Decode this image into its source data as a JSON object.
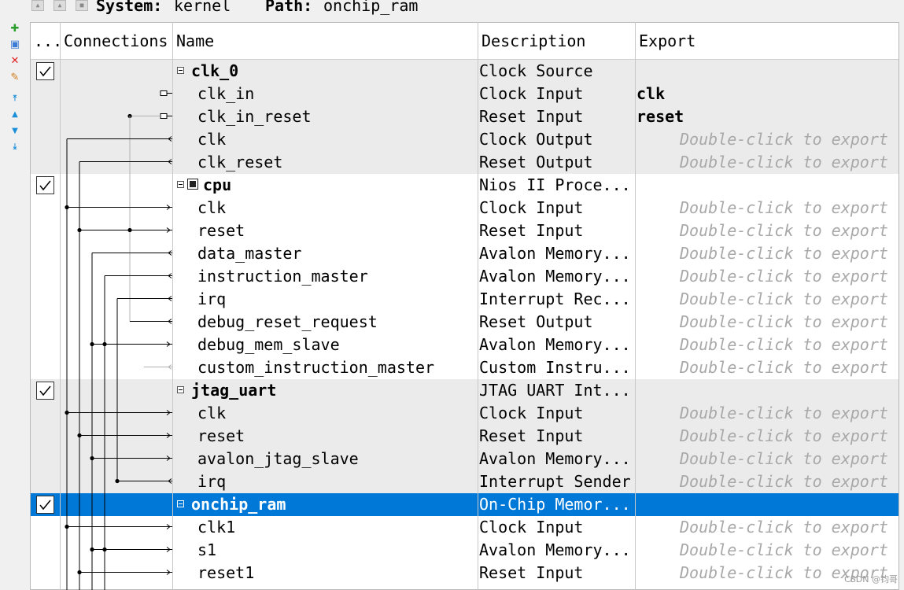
{
  "toolbar": {
    "system_label": "System:",
    "system_value": "kernel",
    "path_label": "Path:",
    "path_value": "onchip_ram"
  },
  "columns": [
    "...",
    "Connections",
    "Name",
    "Description",
    "Export"
  ],
  "rows": [
    {
      "type": "component",
      "checked": true,
      "name": "clk_0",
      "description": "Clock Source",
      "export": "",
      "bg": "grey",
      "has_cpu_icon": false
    },
    {
      "type": "port",
      "name": "clk_in",
      "description": "Clock Input",
      "export": "clk",
      "export_hint": false,
      "bg": "grey"
    },
    {
      "type": "port",
      "name": "clk_in_reset",
      "description": "Reset Input",
      "export": "reset",
      "export_hint": false,
      "bg": "grey"
    },
    {
      "type": "port",
      "name": "clk",
      "description": "Clock Output",
      "export": "Double-click to export",
      "export_hint": true,
      "bg": "grey"
    },
    {
      "type": "port",
      "name": "clk_reset",
      "description": "Reset Output",
      "export": "Double-click to export",
      "export_hint": true,
      "bg": "grey"
    },
    {
      "type": "component",
      "checked": true,
      "name": "cpu",
      "description": "Nios II Proce...",
      "export": "",
      "bg": "white",
      "has_cpu_icon": true
    },
    {
      "type": "port",
      "name": "clk",
      "description": "Clock Input",
      "export": "Double-click to export",
      "export_hint": true,
      "bg": "white"
    },
    {
      "type": "port",
      "name": "reset",
      "description": "Reset Input",
      "export": "Double-click to export",
      "export_hint": true,
      "bg": "white"
    },
    {
      "type": "port",
      "name": "data_master",
      "description": "Avalon Memory...",
      "export": "Double-click to export",
      "export_hint": true,
      "bg": "white"
    },
    {
      "type": "port",
      "name": "instruction_master",
      "description": "Avalon Memory...",
      "export": "Double-click to export",
      "export_hint": true,
      "bg": "white"
    },
    {
      "type": "port",
      "name": "irq",
      "description": "Interrupt Rec...",
      "export": "Double-click to export",
      "export_hint": true,
      "bg": "white"
    },
    {
      "type": "port",
      "name": "debug_reset_request",
      "description": "Reset Output",
      "export": "Double-click to export",
      "export_hint": true,
      "bg": "white"
    },
    {
      "type": "port",
      "name": "debug_mem_slave",
      "description": "Avalon Memory...",
      "export": "Double-click to export",
      "export_hint": true,
      "bg": "white"
    },
    {
      "type": "port",
      "name": "custom_instruction_master",
      "description": "Custom Instru...",
      "export": "Double-click to export",
      "export_hint": true,
      "bg": "white"
    },
    {
      "type": "component",
      "checked": true,
      "name": "jtag_uart",
      "description": "JTAG UART Int...",
      "export": "",
      "bg": "grey",
      "has_cpu_icon": false
    },
    {
      "type": "port",
      "name": "clk",
      "description": "Clock Input",
      "export": "Double-click to export",
      "export_hint": true,
      "bg": "grey"
    },
    {
      "type": "port",
      "name": "reset",
      "description": "Reset Input",
      "export": "Double-click to export",
      "export_hint": true,
      "bg": "grey"
    },
    {
      "type": "port",
      "name": "avalon_jtag_slave",
      "description": "Avalon Memory...",
      "export": "Double-click to export",
      "export_hint": true,
      "bg": "grey"
    },
    {
      "type": "port",
      "name": "irq",
      "description": "Interrupt Sender",
      "export": "Double-click to export",
      "export_hint": true,
      "bg": "grey"
    },
    {
      "type": "component",
      "checked": true,
      "name": "onchip_ram",
      "description": "On-Chip Memor...",
      "export": "",
      "bg": "sel",
      "has_cpu_icon": false
    },
    {
      "type": "port",
      "name": "clk1",
      "description": "Clock Input",
      "export": "Double-click to export",
      "export_hint": true,
      "bg": "white"
    },
    {
      "type": "port",
      "name": "s1",
      "description": "Avalon Memory...",
      "export": "Double-click to export",
      "export_hint": true,
      "bg": "white"
    },
    {
      "type": "port",
      "name": "reset1",
      "description": "Reset Input",
      "export": "Double-click to export",
      "export_hint": true,
      "bg": "white"
    }
  ],
  "watermark": "CSDN @钧哥"
}
